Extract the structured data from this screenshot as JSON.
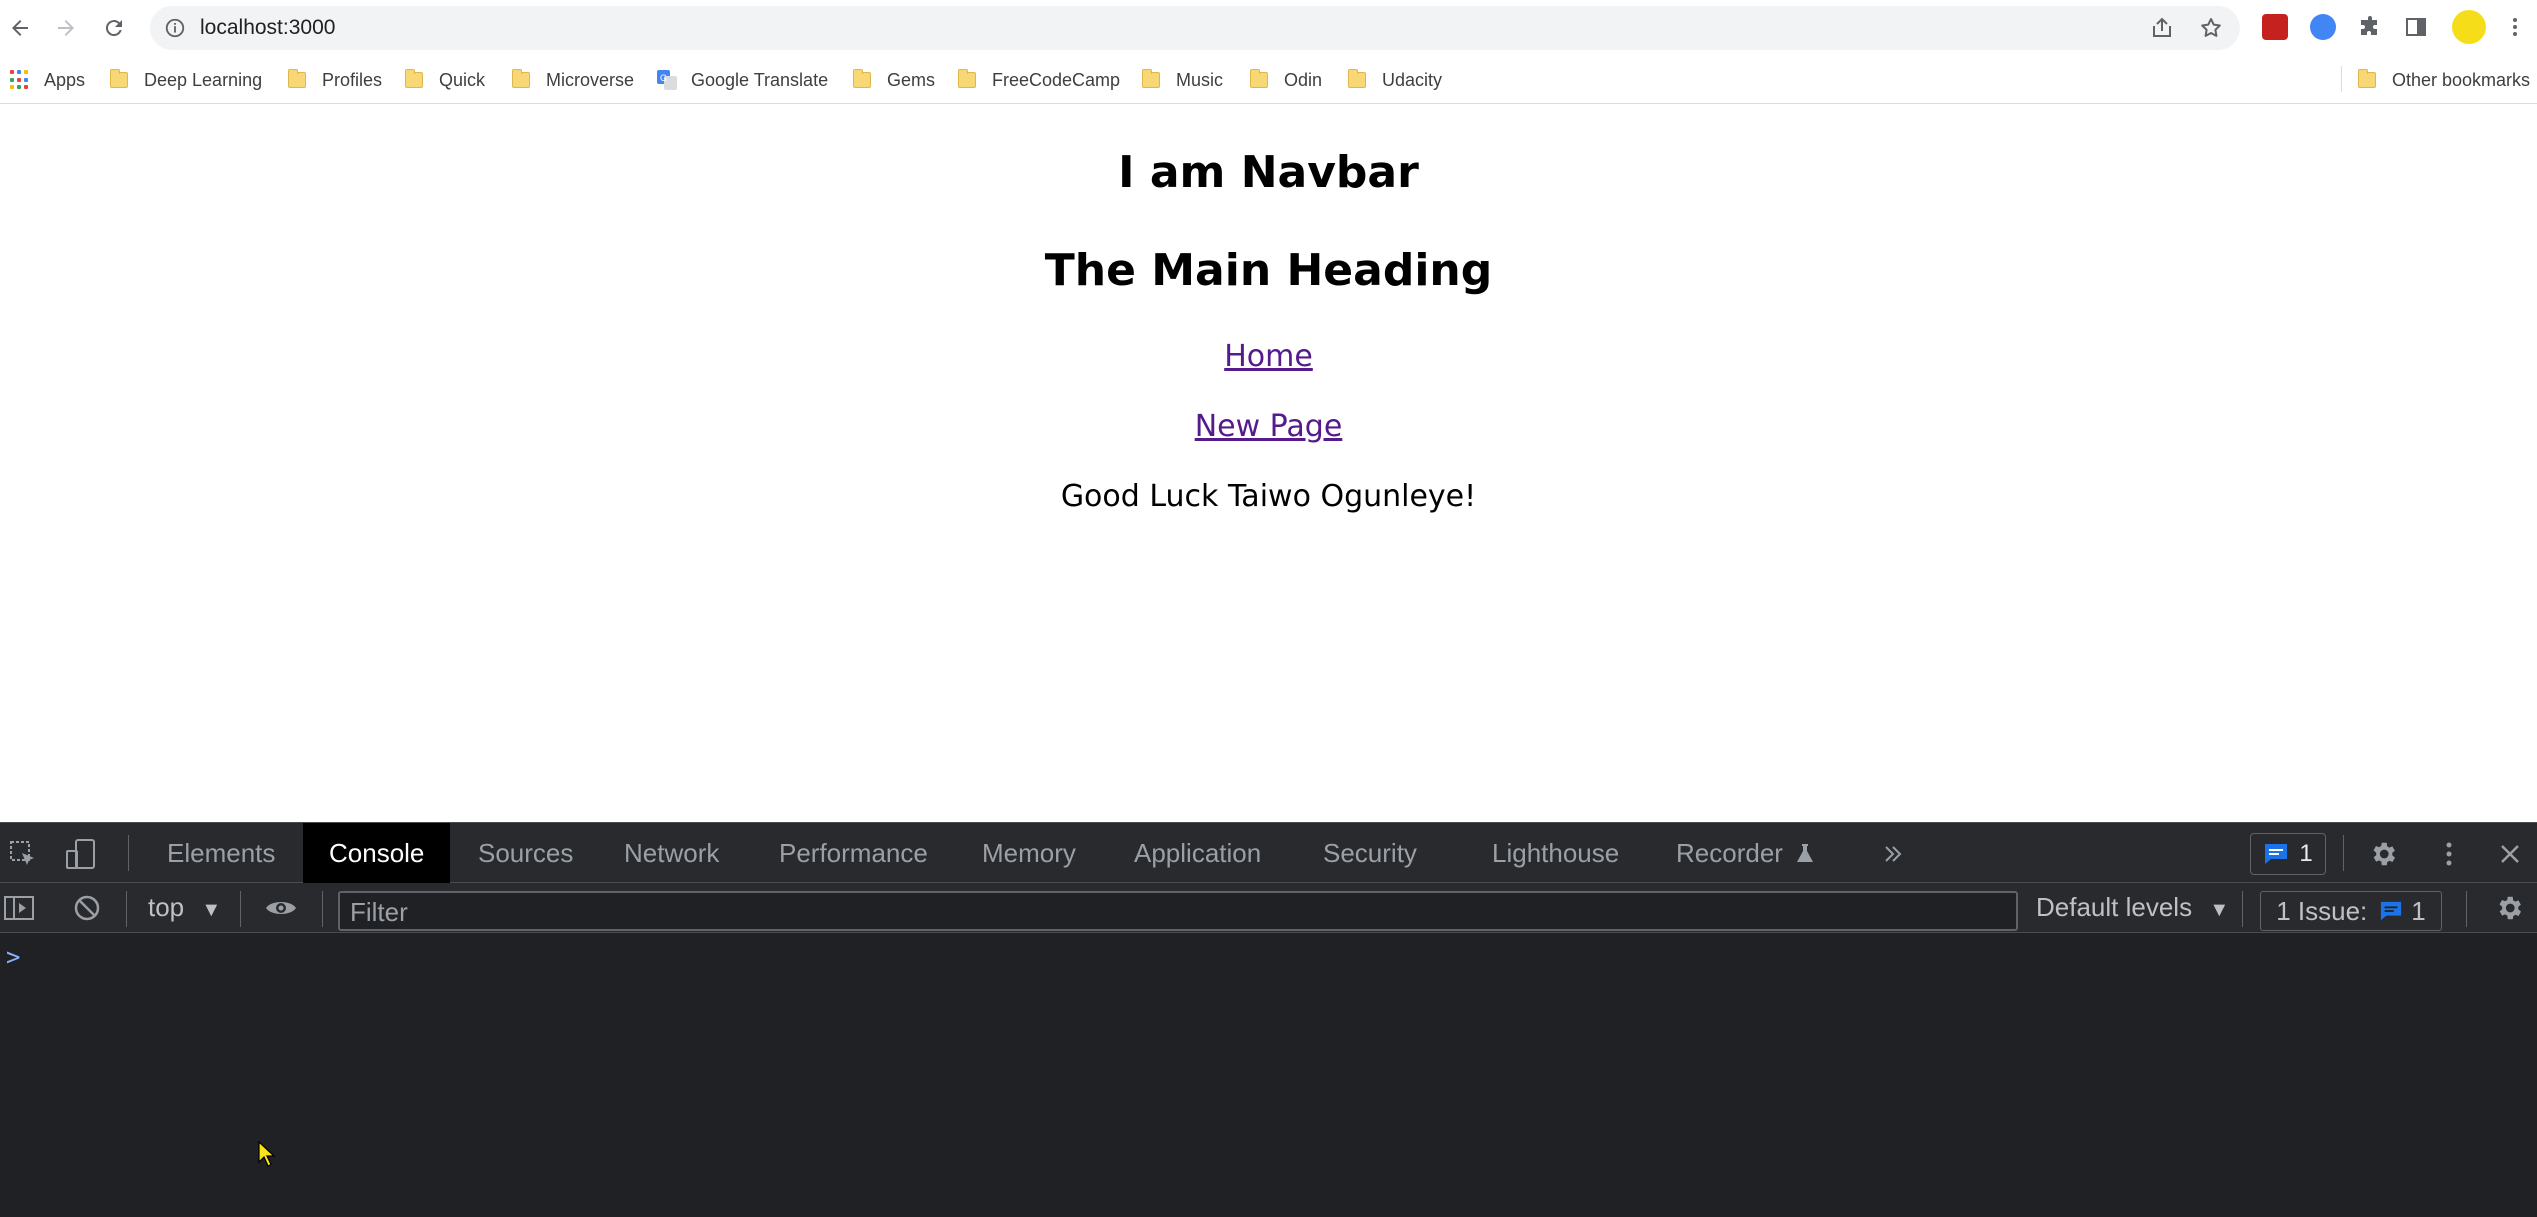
{
  "browser": {
    "url": "localhost:3000"
  },
  "bookmarks": [
    {
      "label": "Apps",
      "icon": "apps-grid-icon"
    },
    {
      "label": "Deep Learning",
      "icon": "folder-icon"
    },
    {
      "label": "Profiles",
      "icon": "folder-icon"
    },
    {
      "label": "Quick",
      "icon": "folder-icon"
    },
    {
      "label": "Microverse",
      "icon": "folder-icon"
    },
    {
      "label": "Google Translate",
      "icon": "google-translate-icon"
    },
    {
      "label": "Gems",
      "icon": "folder-icon"
    },
    {
      "label": "FreeCodeCamp",
      "icon": "folder-icon"
    },
    {
      "label": "Music",
      "icon": "folder-icon"
    },
    {
      "label": "Odin",
      "icon": "folder-icon"
    },
    {
      "label": "Udacity",
      "icon": "folder-icon"
    }
  ],
  "other_bookmarks": "Other bookmarks",
  "page": {
    "navbar_heading": "I am Navbar",
    "main_heading": "The Main Heading",
    "link_home": "Home",
    "link_new_page": "New Page",
    "greeting": "Good Luck Taiwo Ogunleye!"
  },
  "devtools": {
    "tabs": [
      "Elements",
      "Console",
      "Sources",
      "Network",
      "Performance",
      "Memory",
      "Application",
      "Security",
      "Lighthouse",
      "Recorder"
    ],
    "active_tab": "Console",
    "messages_count": "1",
    "context": "top",
    "filter_placeholder": "Filter",
    "levels": "Default levels",
    "issues_label": "1 Issue:",
    "issues_count": "1",
    "prompt": ">"
  },
  "colors": {
    "link_visited": "#551a8b",
    "devtools_bg": "#202124",
    "accent_blue": "#1a73e8"
  }
}
